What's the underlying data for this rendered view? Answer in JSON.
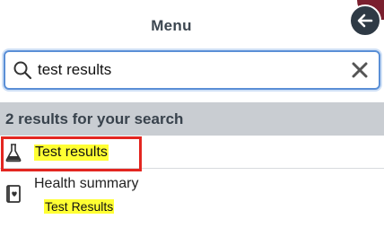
{
  "header": {
    "title": "Menu",
    "back_icon": "arrow-left-icon"
  },
  "search": {
    "value": "test results",
    "placeholder": "",
    "search_icon": "magnifier-icon",
    "clear_icon": "close-x-icon"
  },
  "results": {
    "summary": "2 results for your search",
    "items": [
      {
        "label": "Test results",
        "icon": "flask-icon",
        "highlighted": true
      },
      {
        "label": "Health summary",
        "sublabel": "Test Results",
        "icon": "health-summary-icon"
      }
    ]
  },
  "colors": {
    "header_bar": "#c9cdd2",
    "highlight": "#ffff33",
    "selection_border": "#e32620",
    "search_border": "#5a8fd6",
    "back_button": "#2e3a45",
    "corner_accent": "#7a1f2e"
  }
}
